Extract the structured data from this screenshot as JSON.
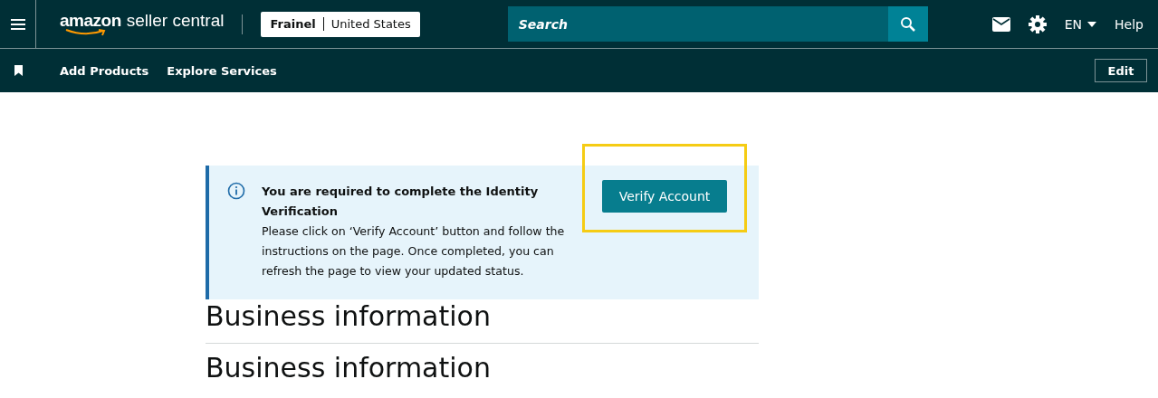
{
  "header": {
    "logo": {
      "brand": "amazon",
      "product": "seller central"
    },
    "account": {
      "store": "Frainel",
      "marketplace": "United States"
    },
    "search": {
      "placeholder": "Search"
    },
    "language": "EN",
    "help": "Help"
  },
  "nav": {
    "links": [
      "Add Products",
      "Explore Services"
    ],
    "edit": "Edit"
  },
  "banner": {
    "title": "You are required to complete the Identity Verification",
    "message": "Please click on ‘Verify Account’ button and follow the instructions on the page. Once completed, you can refresh the page to view your updated status.",
    "button": "Verify Account",
    "highlighted": true
  },
  "sections": [
    "Business information",
    "Business information"
  ]
}
